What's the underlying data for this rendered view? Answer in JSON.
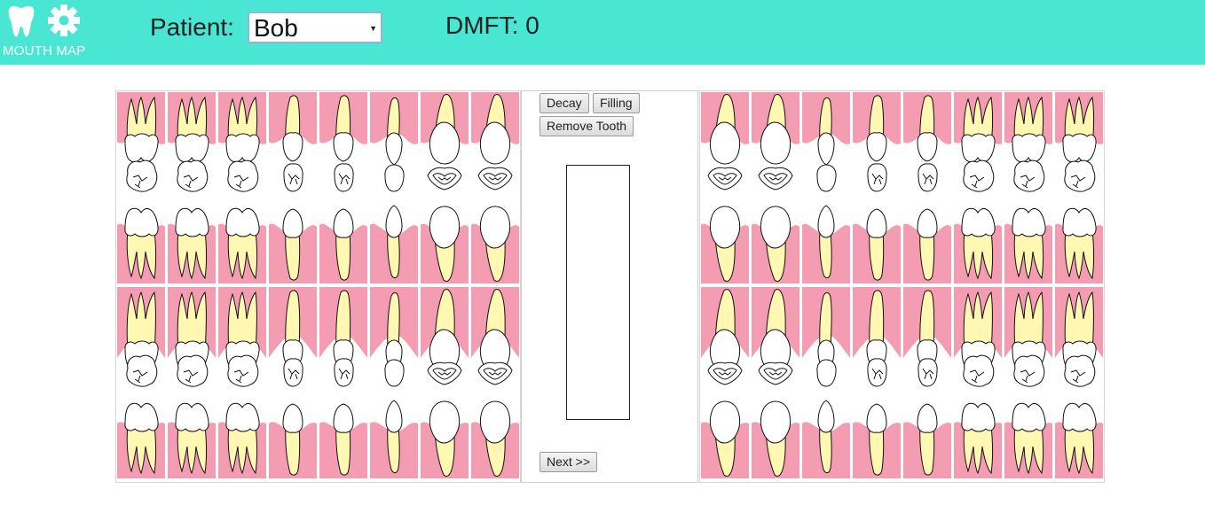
{
  "app": {
    "logo_text": "MOUTH MAP"
  },
  "header": {
    "patient_label": "Patient:",
    "patient_value": "Bob",
    "dmft_text": "DMFT: 0"
  },
  "panel": {
    "decay_label": "Decay",
    "filling_label": "Filling",
    "remove_label": "Remove Tooth",
    "next_label": "Next >>",
    "notes_value": ""
  },
  "colors": {
    "header_bg": "#4ae6d4",
    "gum": "#f49cb2",
    "root": "#fff7b2",
    "crown": "#ffffff"
  },
  "upper_left": [
    "molar",
    "molar",
    "molar",
    "premolar",
    "premolar",
    "canine",
    "incisor",
    "incisor"
  ],
  "upper_right": [
    "incisor",
    "incisor",
    "canine",
    "premolar",
    "premolar",
    "molar",
    "molar",
    "molar"
  ],
  "lower_left": [
    "molar",
    "molar",
    "molar",
    "premolar",
    "premolar",
    "canine",
    "incisor",
    "incisor"
  ],
  "lower_right": [
    "incisor",
    "incisor",
    "canine",
    "premolar",
    "premolar",
    "molar",
    "molar",
    "molar"
  ]
}
